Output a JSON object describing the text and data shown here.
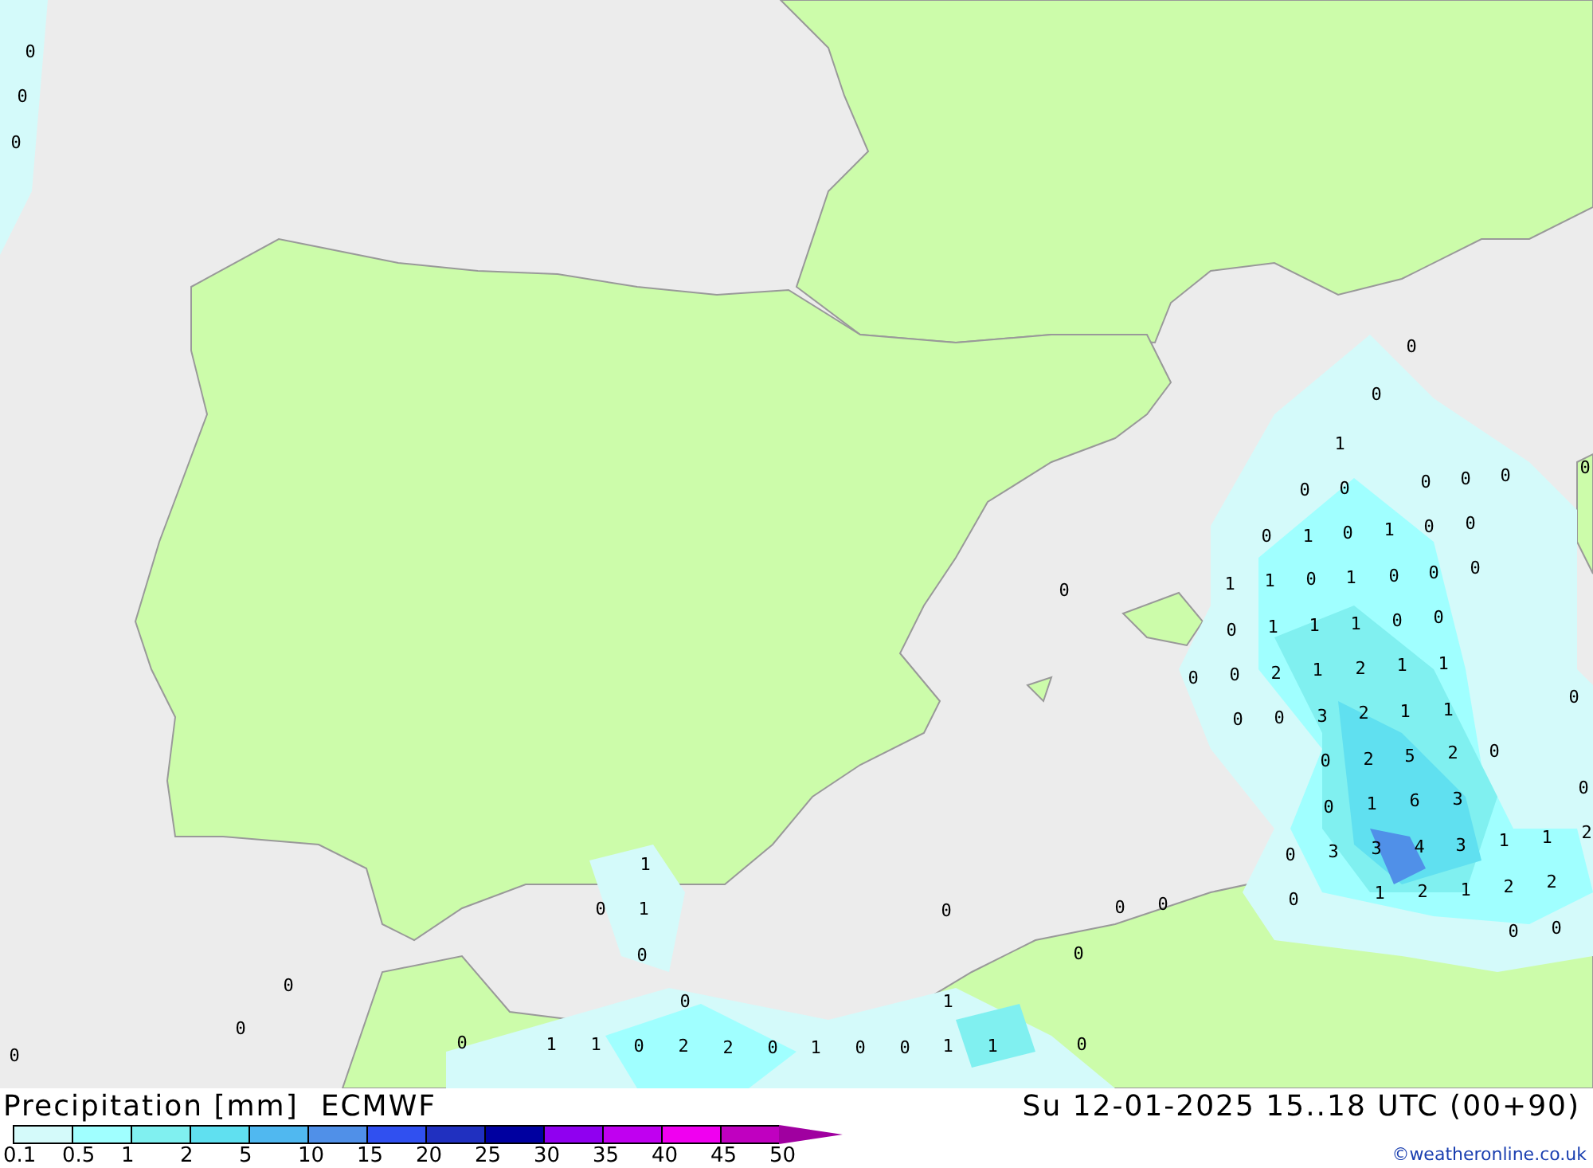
{
  "map": {
    "values": [
      {
        "text": "0"
      },
      {
        "text": "0"
      },
      {
        "text": "1"
      },
      {
        "text": "0"
      },
      {
        "text": "0"
      },
      {
        "text": "0"
      },
      {
        "text": "0"
      },
      {
        "text": "0"
      },
      {
        "text": "0"
      },
      {
        "text": "0"
      },
      {
        "text": "1"
      },
      {
        "text": "0"
      },
      {
        "text": "1"
      },
      {
        "text": "0"
      },
      {
        "text": "0"
      },
      {
        "text": "1"
      },
      {
        "text": "1"
      },
      {
        "text": "0"
      },
      {
        "text": "1"
      },
      {
        "text": "0"
      },
      {
        "text": "0"
      },
      {
        "text": "0"
      },
      {
        "text": "0"
      },
      {
        "text": "1"
      },
      {
        "text": "1"
      },
      {
        "text": "1"
      },
      {
        "text": "0"
      },
      {
        "text": "0"
      },
      {
        "text": "0"
      },
      {
        "text": "0"
      },
      {
        "text": "2"
      },
      {
        "text": "1"
      },
      {
        "text": "2"
      },
      {
        "text": "1"
      },
      {
        "text": "1"
      },
      {
        "text": "0"
      },
      {
        "text": "0"
      },
      {
        "text": "3"
      },
      {
        "text": "2"
      },
      {
        "text": "1"
      },
      {
        "text": "1"
      },
      {
        "text": "0"
      },
      {
        "text": "0"
      },
      {
        "text": "2"
      },
      {
        "text": "5"
      },
      {
        "text": "2"
      },
      {
        "text": "0"
      },
      {
        "text": "0"
      },
      {
        "text": "1"
      },
      {
        "text": "6"
      },
      {
        "text": "3"
      },
      {
        "text": "0"
      },
      {
        "text": "0"
      },
      {
        "text": "3"
      },
      {
        "text": "3"
      },
      {
        "text": "4"
      },
      {
        "text": "3"
      },
      {
        "text": "1"
      },
      {
        "text": "1"
      },
      {
        "text": "2"
      },
      {
        "text": "0"
      },
      {
        "text": "1"
      },
      {
        "text": "2"
      },
      {
        "text": "1"
      },
      {
        "text": "2"
      },
      {
        "text": "2"
      },
      {
        "text": "0"
      },
      {
        "text": "0"
      },
      {
        "text": "1"
      },
      {
        "text": "0"
      },
      {
        "text": "1"
      },
      {
        "text": "0"
      },
      {
        "text": "0"
      },
      {
        "text": "0"
      },
      {
        "text": "0"
      },
      {
        "text": "0"
      },
      {
        "text": "1"
      },
      {
        "text": "0"
      },
      {
        "text": "1"
      },
      {
        "text": "1"
      },
      {
        "text": "0"
      },
      {
        "text": "2"
      },
      {
        "text": "2"
      },
      {
        "text": "0"
      },
      {
        "text": "1"
      },
      {
        "text": "0"
      },
      {
        "text": "0"
      },
      {
        "text": "1"
      },
      {
        "text": "1"
      },
      {
        "text": "0"
      },
      {
        "text": "0"
      },
      {
        "text": "0"
      },
      {
        "text": "0"
      },
      {
        "text": "0"
      },
      {
        "text": "0"
      },
      {
        "text": "0"
      },
      {
        "text": "0"
      },
      {
        "text": "0"
      }
    ]
  },
  "footer": {
    "title": "Precipitation [mm]",
    "model": "ECMWF",
    "valid_time": "Su 12-01-2025 15..18 UTC (00+90)",
    "credit": "©weatheronline.co.uk",
    "legend": {
      "colors": [
        {
          "color": "#d4fafa"
        },
        {
          "color": "#a0ffff"
        },
        {
          "color": "#80f0f0"
        },
        {
          "color": "#60e0f0"
        },
        {
          "color": "#50b8f0"
        },
        {
          "color": "#5090e8"
        },
        {
          "color": "#3050f0"
        },
        {
          "color": "#2030c0"
        },
        {
          "color": "#0000a0"
        },
        {
          "color": "#9000f0"
        },
        {
          "color": "#c000f0"
        },
        {
          "color": "#f000f0"
        },
        {
          "color": "#c000c0"
        }
      ],
      "labels": [
        "0.1",
        "0.5",
        "1",
        "2",
        "5",
        "10",
        "15",
        "20",
        "25",
        "30",
        "35",
        "40",
        "45",
        "50"
      ]
    }
  }
}
